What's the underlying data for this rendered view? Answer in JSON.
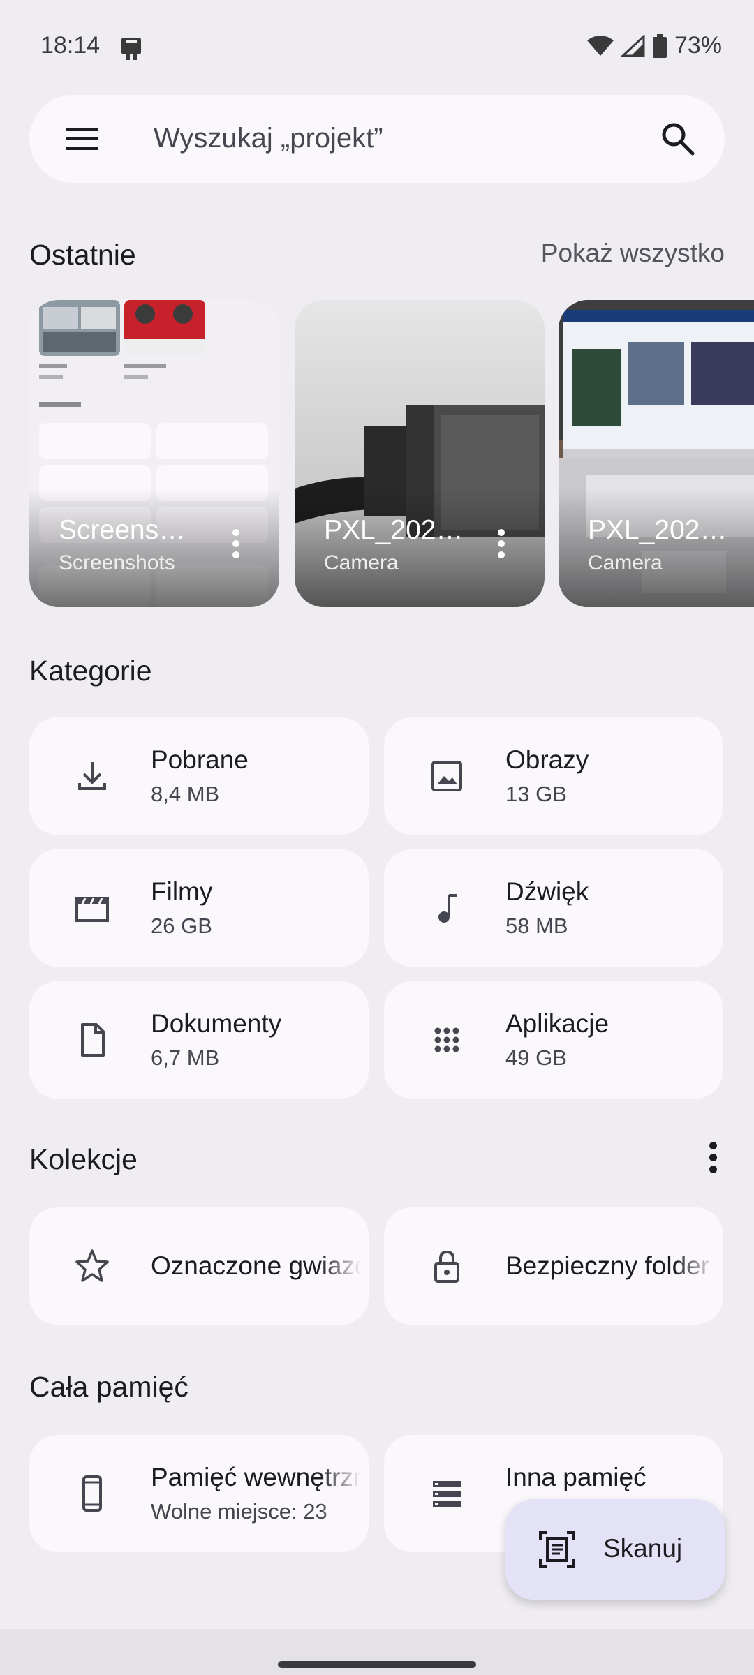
{
  "status_bar": {
    "time": "18:14",
    "battery_percent": "73%",
    "icons": [
      "app-notification-icon",
      "wifi-icon",
      "cell-signal-icon",
      "battery-icon"
    ]
  },
  "search": {
    "placeholder": "Wyszukaj „projekt”"
  },
  "recents": {
    "title": "Ostatnie",
    "show_all_label": "Pokaż wszystko",
    "items": [
      {
        "name": "Screens…",
        "source": "Screenshots"
      },
      {
        "name": "PXL_202…",
        "source": "Camera"
      },
      {
        "name": "PXL_202…",
        "source": "Camera"
      }
    ]
  },
  "categories": {
    "title": "Kategorie",
    "items": [
      {
        "label": "Pobrane",
        "size": "8,4 MB",
        "icon": "download-icon"
      },
      {
        "label": "Obrazy",
        "size": "13 GB",
        "icon": "image-icon"
      },
      {
        "label": "Filmy",
        "size": "26 GB",
        "icon": "movie-icon"
      },
      {
        "label": "Dźwięk",
        "size": "58 MB",
        "icon": "music-note-icon"
      },
      {
        "label": "Dokumenty",
        "size": "6,7 MB",
        "icon": "document-icon"
      },
      {
        "label": "Aplikacje",
        "size": "49 GB",
        "icon": "apps-grid-icon"
      }
    ]
  },
  "collections": {
    "title": "Kolekcje",
    "items": [
      {
        "label": "Oznaczone gwiazdką",
        "icon": "star-icon"
      },
      {
        "label": "Bezpieczny folder",
        "icon": "lock-icon"
      }
    ]
  },
  "storage": {
    "title": "Cała pamięć",
    "items": [
      {
        "label": "Pamięć wewnętrzna",
        "detail": "Wolne miejsce: 23",
        "icon": "phone-icon"
      },
      {
        "label": "Inna pamięć",
        "detail": "",
        "icon": "storage-icon"
      }
    ]
  },
  "fab": {
    "label": "Skanuj",
    "icon": "document-scanner-icon"
  },
  "colors": {
    "background": "#efedf1",
    "card": "#fbf8fb",
    "fab": "#e4e2f6",
    "text_primary": "#1c1b1f",
    "text_secondary": "#45464f"
  }
}
